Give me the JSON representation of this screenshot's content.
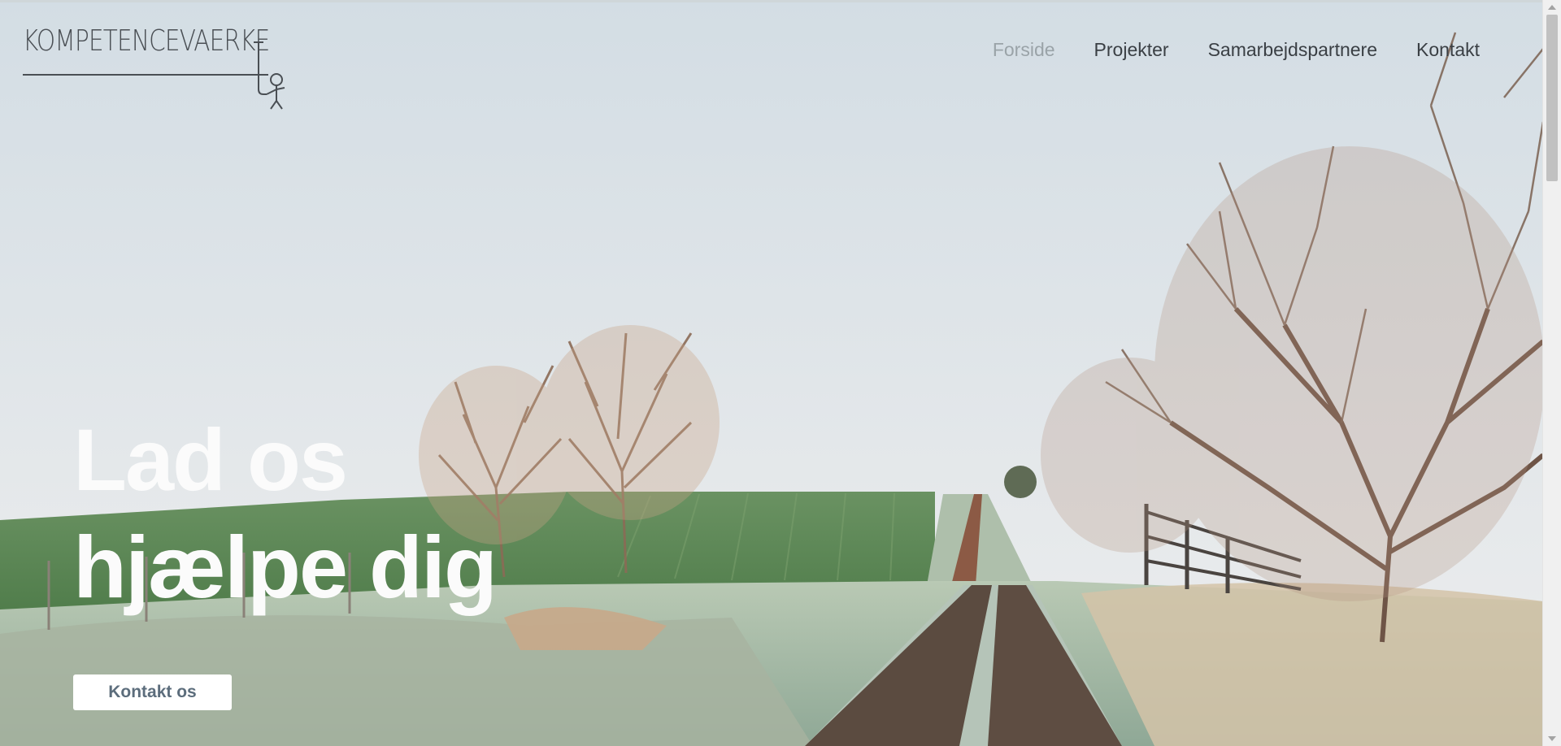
{
  "site": {
    "logo_text": "KOMPETENCEVAERKE"
  },
  "nav": {
    "items": [
      {
        "label": "Forside",
        "active": true
      },
      {
        "label": "Projekter",
        "active": false
      },
      {
        "label": "Samarbejdspartnere",
        "active": false
      },
      {
        "label": "Kontakt",
        "active": false
      }
    ]
  },
  "hero": {
    "headline_line1": "Lad os",
    "headline_line2": "hjælpe dig",
    "cta_label": "Kontakt os",
    "background": "frosty-country-road-with-bare-trees",
    "colors": {
      "sky": "#dfe4e8",
      "field": "#5f8a55",
      "text": "#fbfbfb",
      "cta_text": "#5c6d7c"
    }
  }
}
